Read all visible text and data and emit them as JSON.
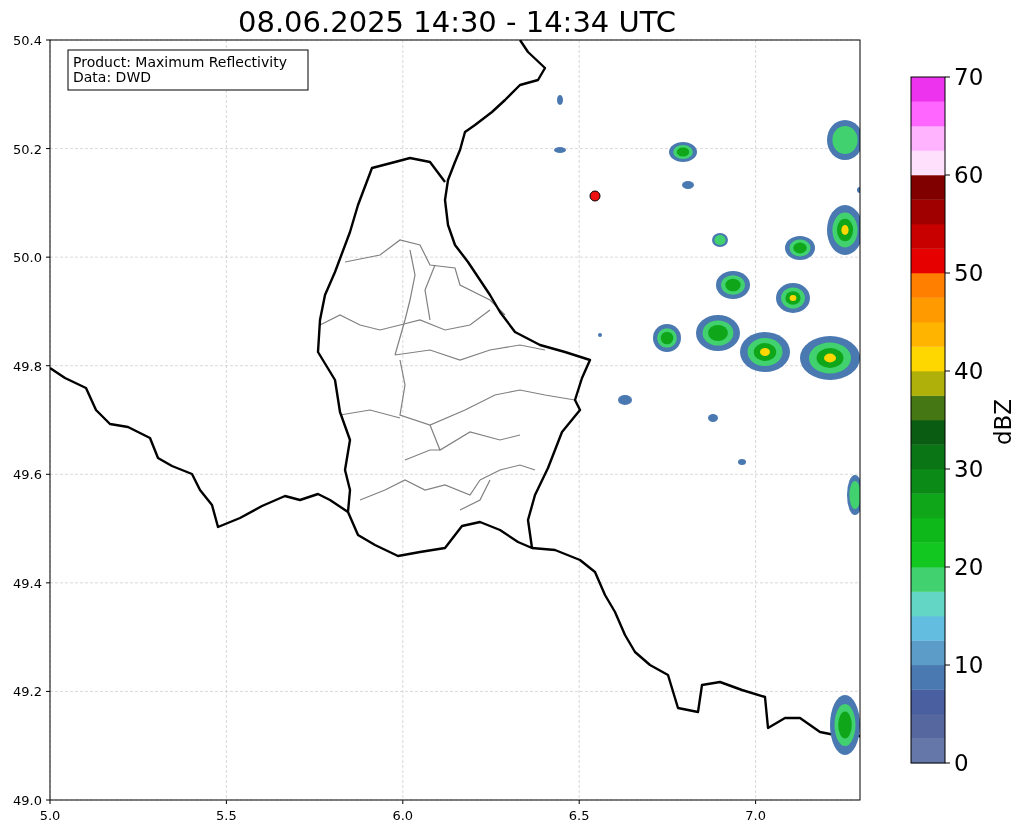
{
  "title": "08.06.2025 14:30 - 14:34 UTC",
  "info_box": {
    "lines": [
      "Product: Maximum Reflectivity",
      "Data: DWD"
    ]
  },
  "map": {
    "x_ticks": [
      "5.0",
      "5.5",
      "6.0",
      "6.5",
      "7.0"
    ],
    "y_ticks": [
      "50.4",
      "50.2",
      "50.0",
      "49.8",
      "49.6",
      "49.4",
      "49.2",
      "49.0"
    ]
  },
  "colorbar": {
    "label": "dBZ",
    "ticks": [
      "70",
      "60",
      "50",
      "40",
      "30",
      "20",
      "10",
      "0"
    ],
    "steps": [
      {
        "color": "#6577a8"
      },
      {
        "color": "#56679f"
      },
      {
        "color": "#4a5fa0"
      },
      {
        "color": "#4a78b0"
      },
      {
        "color": "#5b9cc8"
      },
      {
        "color": "#63bde0"
      },
      {
        "color": "#63d6c6"
      },
      {
        "color": "#41d26f"
      },
      {
        "color": "#12c71f"
      },
      {
        "color": "#0fb81a"
      },
      {
        "color": "#0fa61a"
      },
      {
        "color": "#0c8a18"
      },
      {
        "color": "#0a7515"
      },
      {
        "color": "#0a5c12"
      },
      {
        "color": "#457814"
      },
      {
        "color": "#b0b00a"
      },
      {
        "color": "#ffd700"
      },
      {
        "color": "#ffb400"
      },
      {
        "color": "#ff9a00"
      },
      {
        "color": "#ff7f00"
      },
      {
        "color": "#e60000"
      },
      {
        "color": "#c80000"
      },
      {
        "color": "#a00000"
      },
      {
        "color": "#800000"
      },
      {
        "color": "#ffe0fc"
      },
      {
        "color": "#ffb3ff"
      },
      {
        "color": "#ff66ff"
      },
      {
        "color": "#ee33ee"
      }
    ]
  }
}
